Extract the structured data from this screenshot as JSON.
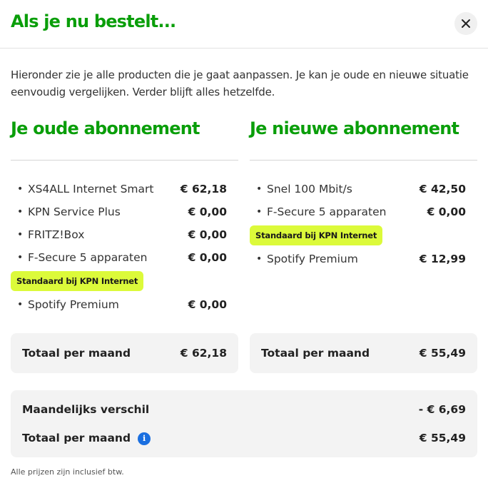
{
  "header": {
    "title": "Als je nu bestelt..."
  },
  "intro": "Hieronder zie je alle producten die je gaat aanpassen. Je kan je oude en nieuwe situatie eenvoudig vergelijken. Verder blijft alles hetzelfde.",
  "old": {
    "title": "Je oude abonnement",
    "items": [
      {
        "name": "XS4ALL Internet Smart",
        "price": "€ 62,18"
      },
      {
        "name": "KPN Service Plus",
        "price": "€ 0,00"
      },
      {
        "name": "FRITZ!Box",
        "price": "€ 0,00"
      },
      {
        "name": "F-Secure 5 apparaten",
        "price": "€ 0,00"
      }
    ],
    "badge": "Standaard bij KPN Internet",
    "extra_items": [
      {
        "name": "Spotify Premium",
        "price": "€ 0,00"
      }
    ],
    "total_label": "Totaal per maand",
    "total_value": "€ 62,18"
  },
  "new": {
    "title": "Je nieuwe abonnement",
    "items": [
      {
        "name": "Snel 100 Mbit/s",
        "price": "€ 42,50"
      },
      {
        "name": "F-Secure 5 apparaten",
        "price": "€ 0,00"
      }
    ],
    "badge": "Standaard bij KPN Internet",
    "extra_items": [
      {
        "name": "Spotify Premium",
        "price": "€ 12,99"
      }
    ],
    "total_label": "Totaal per maand",
    "total_value": "€ 55,49"
  },
  "summary": {
    "diff_label": "Maandelijks verschil",
    "diff_value": "- € 6,69",
    "total_label": "Totaal per maand",
    "total_value": "€ 55,49",
    "info_glyph": "i"
  },
  "footnote": "Alle prijzen zijn inclusief btw.",
  "colors": {
    "accent_green": "#0a9e0a",
    "badge_yellow": "#dcfa3a",
    "info_blue": "#1a6fe0",
    "panel_grey": "#f3f3f3"
  }
}
